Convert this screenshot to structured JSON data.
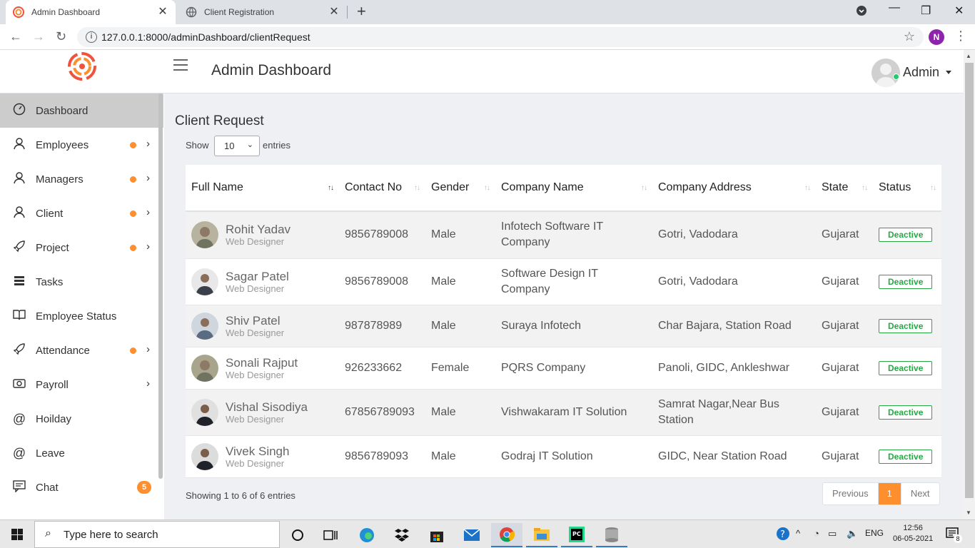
{
  "browser": {
    "tabs": [
      {
        "title": "Admin Dashboard",
        "active": true
      },
      {
        "title": "Client Registration",
        "active": false
      }
    ],
    "url": "127.0.0.1:8000/adminDashboard/clientRequest",
    "profile_initial": "N"
  },
  "header": {
    "title": "Admin Dashboard",
    "user": "Admin"
  },
  "sidebar": {
    "items": [
      {
        "label": "Dashboard",
        "icon": "dashboard-icon"
      },
      {
        "label": "Employees",
        "icon": "user-icon"
      },
      {
        "label": "Managers",
        "icon": "user-icon"
      },
      {
        "label": "Client",
        "icon": "user-icon"
      },
      {
        "label": "Project",
        "icon": "rocket-icon"
      },
      {
        "label": "Tasks",
        "icon": "tasks-icon"
      },
      {
        "label": "Employee Status",
        "icon": "book-icon"
      },
      {
        "label": "Attendance",
        "icon": "rocket-icon"
      },
      {
        "label": "Payroll",
        "icon": "camera-icon"
      },
      {
        "label": "Hoilday",
        "icon": "at-icon"
      },
      {
        "label": "Leave",
        "icon": "at-icon"
      },
      {
        "label": "Chat",
        "icon": "chat-icon",
        "badge": "5"
      }
    ]
  },
  "main": {
    "title": "Client Request",
    "show_label": "Show",
    "entries_value": "10",
    "entries_label": "entries",
    "columns": [
      "Full Name",
      "Contact No",
      "Gender",
      "Company Name",
      "Company Address",
      "State",
      "Status"
    ],
    "rows": [
      {
        "name": "Rohit Yadav",
        "role": "Web Designer",
        "contact": "9856789008",
        "gender": "Male",
        "company": "Infotech Software IT Company",
        "address": "Gotri, Vadodara",
        "state": "Gujarat",
        "status": "Deactive"
      },
      {
        "name": "Sagar Patel",
        "role": "Web Designer",
        "contact": "9856789008",
        "gender": "Male",
        "company": "Software Design IT Company",
        "address": "Gotri, Vadodara",
        "state": "Gujarat",
        "status": "Deactive"
      },
      {
        "name": "Shiv Patel",
        "role": "Web Designer",
        "contact": "987878989",
        "gender": "Male",
        "company": "Suraya Infotech",
        "address": "Char Bajara, Station Road",
        "state": "Gujarat",
        "status": "Deactive"
      },
      {
        "name": "Sonali Rajput",
        "role": "Web Designer",
        "contact": "926233662",
        "gender": "Female",
        "company": "PQRS Company",
        "address": "Panoli, GIDC, Ankleshwar",
        "state": "Gujarat",
        "status": "Deactive"
      },
      {
        "name": "Vishal Sisodiya",
        "role": "Web Designer",
        "contact": "67856789093",
        "gender": "Male",
        "company": "Vishwakaram IT Solution",
        "address": "Samrat Nagar,Near Bus Station",
        "state": "Gujarat",
        "status": "Deactive"
      },
      {
        "name": "Vivek Singh",
        "role": "Web Designer",
        "contact": "9856789093",
        "gender": "Male",
        "company": "Godraj IT Solution",
        "address": "GIDC, Near Station Road",
        "state": "Gujarat",
        "status": "Deactive"
      }
    ],
    "info": "Showing 1 to 6 of 6 entries",
    "pagination": {
      "previous": "Previous",
      "current": "1",
      "next": "Next"
    }
  },
  "taskbar": {
    "search_placeholder": "Type here to search",
    "language": "ENG",
    "time": "12:56",
    "date": "06-05-2021",
    "notifications": "8"
  },
  "colors": {
    "accent": "#fd8f2f",
    "status": "#28a745",
    "sidebar_active": "#cccccc"
  }
}
